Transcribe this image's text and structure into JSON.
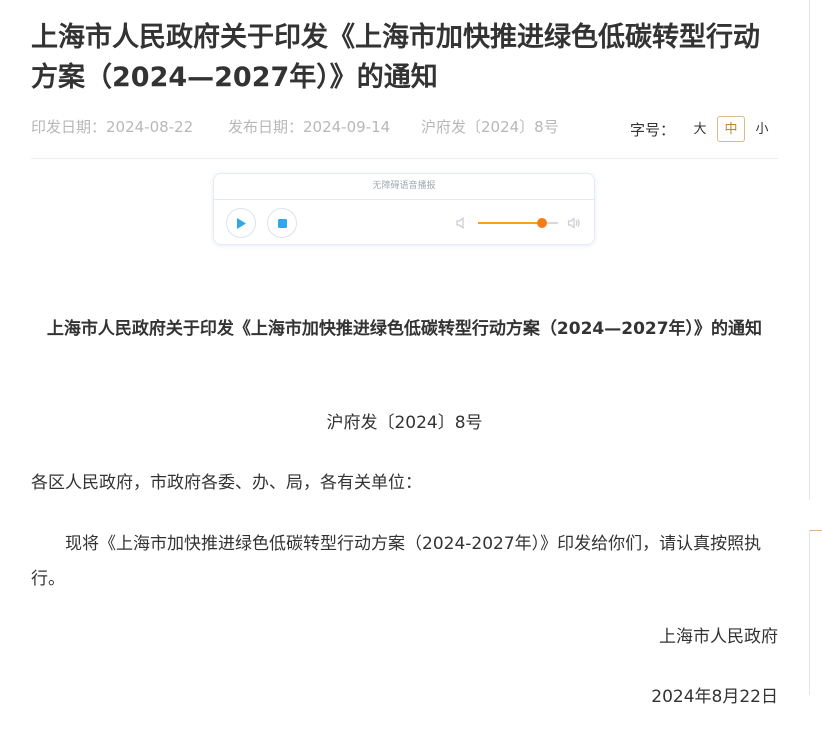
{
  "header": {
    "title": "上海市人民政府关于印发《上海市加快推进绿色低碳转型行动方案（2024—2027年）》的通知",
    "print_date": "印发日期：2024-08-22",
    "publish_date": "发布日期：2024-09-14",
    "doc_number": "沪府发〔2024〕8号",
    "font_size_label": "字号：",
    "font_sizes": [
      "大",
      "中",
      "小"
    ],
    "font_size_selected": "中"
  },
  "player": {
    "label": "无障碍语音播报",
    "volume": 0.8,
    "icons": [
      "play-icon",
      "stop-icon",
      "volume-low-icon",
      "volume-high-icon"
    ],
    "colors": {
      "accent": "#2ea8e8",
      "volume_fill": "#f5a218",
      "volume_knob": "#f77b1e"
    }
  },
  "document": {
    "title": "上海市人民政府关于印发《上海市加快推进绿色低碳转型行动方案（2024—2027年）》的通知",
    "number": "沪府发〔2024〕8号",
    "addressee": "各区人民政府，市政府各委、办、局，各有关单位：",
    "body": "现将《上海市加快推进绿色低碳转型行动方案（2024-2027年）》印发给你们，请认真按照执行。",
    "signature": "上海市人民政府",
    "date": "2024年8月22日"
  }
}
